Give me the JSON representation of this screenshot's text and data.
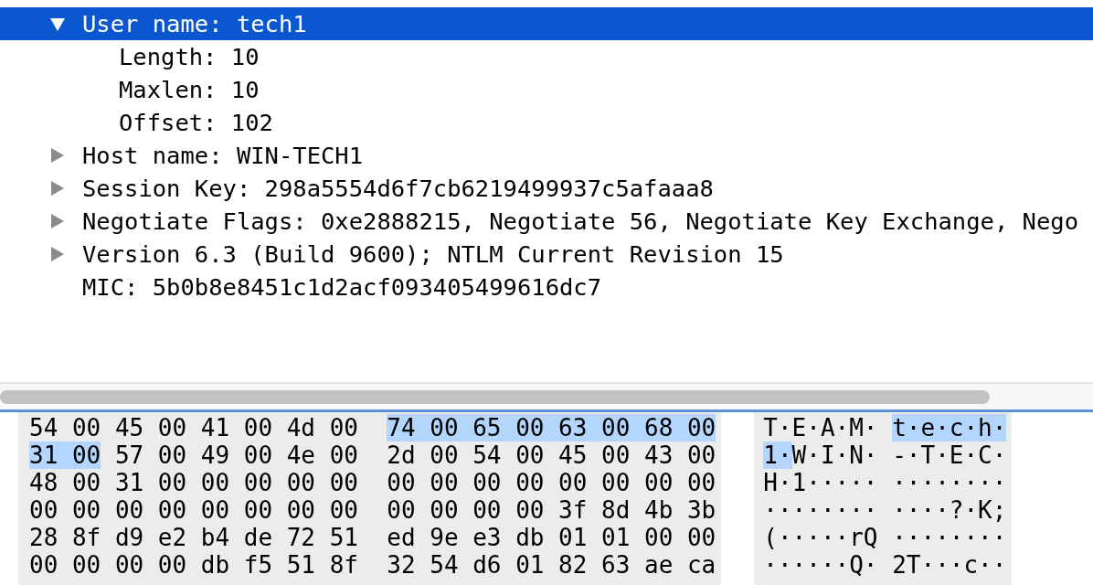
{
  "tree": [
    {
      "kind": "branch",
      "label": "User name: tech1",
      "selected": true,
      "expanded": true,
      "children": [
        {
          "label": "Length: 10",
          "selected": false
        },
        {
          "label": "Maxlen: 10",
          "selected": false
        },
        {
          "label": "Offset: 102",
          "selected": false
        }
      ]
    },
    {
      "kind": "branch",
      "label": "Host name: WIN-TECH1",
      "selected": false,
      "expanded": false
    },
    {
      "kind": "branch",
      "label": "Session Key: 298a5554d6f7cb6219499937c5afaaa8",
      "selected": false,
      "expanded": false
    },
    {
      "kind": "branch",
      "label": "Negotiate Flags: 0xe2888215, Negotiate 56, Negotiate Key Exchange, Nego",
      "selected": false,
      "expanded": false
    },
    {
      "kind": "branch",
      "label": "Version 6.3 (Build 9600); NTLM Current Revision 15",
      "selected": false,
      "expanded": false
    },
    {
      "kind": "leaf",
      "label": "MIC: 5b0b8e8451c1d2acf093405499616dc7",
      "selected": false
    }
  ],
  "hex_rows": [
    {
      "bytes": [
        {
          "hex": "54",
          "char": "T",
          "selected": false
        },
        {
          "hex": "00",
          "char": "·",
          "selected": false
        },
        {
          "hex": "45",
          "char": "E",
          "selected": false
        },
        {
          "hex": "00",
          "char": "·",
          "selected": false
        },
        {
          "hex": "41",
          "char": "A",
          "selected": false
        },
        {
          "hex": "00",
          "char": "·",
          "selected": false
        },
        {
          "hex": "4d",
          "char": "M",
          "selected": false
        },
        {
          "hex": "00",
          "char": "·",
          "selected": false
        },
        {
          "hex": "74",
          "char": "t",
          "selected": true
        },
        {
          "hex": "00",
          "char": "·",
          "selected": true
        },
        {
          "hex": "65",
          "char": "e",
          "selected": true
        },
        {
          "hex": "00",
          "char": "·",
          "selected": true
        },
        {
          "hex": "63",
          "char": "c",
          "selected": true
        },
        {
          "hex": "00",
          "char": "·",
          "selected": true
        },
        {
          "hex": "68",
          "char": "h",
          "selected": true
        },
        {
          "hex": "00",
          "char": "·",
          "selected": true
        }
      ]
    },
    {
      "bytes": [
        {
          "hex": "31",
          "char": "1",
          "selected": true
        },
        {
          "hex": "00",
          "char": "·",
          "selected": true
        },
        {
          "hex": "57",
          "char": "W",
          "selected": false
        },
        {
          "hex": "00",
          "char": "·",
          "selected": false
        },
        {
          "hex": "49",
          "char": "I",
          "selected": false
        },
        {
          "hex": "00",
          "char": "·",
          "selected": false
        },
        {
          "hex": "4e",
          "char": "N",
          "selected": false
        },
        {
          "hex": "00",
          "char": "·",
          "selected": false
        },
        {
          "hex": "2d",
          "char": "-",
          "selected": false
        },
        {
          "hex": "00",
          "char": "·",
          "selected": false
        },
        {
          "hex": "54",
          "char": "T",
          "selected": false
        },
        {
          "hex": "00",
          "char": "·",
          "selected": false
        },
        {
          "hex": "45",
          "char": "E",
          "selected": false
        },
        {
          "hex": "00",
          "char": "·",
          "selected": false
        },
        {
          "hex": "43",
          "char": "C",
          "selected": false
        },
        {
          "hex": "00",
          "char": "·",
          "selected": false
        }
      ]
    },
    {
      "bytes": [
        {
          "hex": "48",
          "char": "H",
          "selected": false
        },
        {
          "hex": "00",
          "char": "·",
          "selected": false
        },
        {
          "hex": "31",
          "char": "1",
          "selected": false
        },
        {
          "hex": "00",
          "char": "·",
          "selected": false
        },
        {
          "hex": "00",
          "char": "·",
          "selected": false
        },
        {
          "hex": "00",
          "char": "·",
          "selected": false
        },
        {
          "hex": "00",
          "char": "·",
          "selected": false
        },
        {
          "hex": "00",
          "char": "·",
          "selected": false
        },
        {
          "hex": "00",
          "char": "·",
          "selected": false
        },
        {
          "hex": "00",
          "char": "·",
          "selected": false
        },
        {
          "hex": "00",
          "char": "·",
          "selected": false
        },
        {
          "hex": "00",
          "char": "·",
          "selected": false
        },
        {
          "hex": "00",
          "char": "·",
          "selected": false
        },
        {
          "hex": "00",
          "char": "·",
          "selected": false
        },
        {
          "hex": "00",
          "char": "·",
          "selected": false
        },
        {
          "hex": "00",
          "char": "·",
          "selected": false
        }
      ]
    },
    {
      "bytes": [
        {
          "hex": "00",
          "char": "·",
          "selected": false
        },
        {
          "hex": "00",
          "char": "·",
          "selected": false
        },
        {
          "hex": "00",
          "char": "·",
          "selected": false
        },
        {
          "hex": "00",
          "char": "·",
          "selected": false
        },
        {
          "hex": "00",
          "char": "·",
          "selected": false
        },
        {
          "hex": "00",
          "char": "·",
          "selected": false
        },
        {
          "hex": "00",
          "char": "·",
          "selected": false
        },
        {
          "hex": "00",
          "char": "·",
          "selected": false
        },
        {
          "hex": "00",
          "char": "·",
          "selected": false
        },
        {
          "hex": "00",
          "char": "·",
          "selected": false
        },
        {
          "hex": "00",
          "char": "·",
          "selected": false
        },
        {
          "hex": "00",
          "char": "·",
          "selected": false
        },
        {
          "hex": "3f",
          "char": "?",
          "selected": false
        },
        {
          "hex": "8d",
          "char": "·",
          "selected": false
        },
        {
          "hex": "4b",
          "char": "K",
          "selected": false
        },
        {
          "hex": "3b",
          "char": ";",
          "selected": false
        }
      ]
    },
    {
      "bytes": [
        {
          "hex": "28",
          "char": "(",
          "selected": false
        },
        {
          "hex": "8f",
          "char": "·",
          "selected": false
        },
        {
          "hex": "d9",
          "char": "·",
          "selected": false
        },
        {
          "hex": "e2",
          "char": "·",
          "selected": false
        },
        {
          "hex": "b4",
          "char": "·",
          "selected": false
        },
        {
          "hex": "de",
          "char": "·",
          "selected": false
        },
        {
          "hex": "72",
          "char": "r",
          "selected": false
        },
        {
          "hex": "51",
          "char": "Q",
          "selected": false
        },
        {
          "hex": "ed",
          "char": "·",
          "selected": false
        },
        {
          "hex": "9e",
          "char": "·",
          "selected": false
        },
        {
          "hex": "e3",
          "char": "·",
          "selected": false
        },
        {
          "hex": "db",
          "char": "·",
          "selected": false
        },
        {
          "hex": "01",
          "char": "·",
          "selected": false
        },
        {
          "hex": "01",
          "char": "·",
          "selected": false
        },
        {
          "hex": "00",
          "char": "·",
          "selected": false
        },
        {
          "hex": "00",
          "char": "·",
          "selected": false
        }
      ]
    },
    {
      "bytes": [
        {
          "hex": "00",
          "char": "·",
          "selected": false
        },
        {
          "hex": "00",
          "char": "·",
          "selected": false
        },
        {
          "hex": "00",
          "char": "·",
          "selected": false
        },
        {
          "hex": "00",
          "char": "·",
          "selected": false
        },
        {
          "hex": "db",
          "char": "·",
          "selected": false
        },
        {
          "hex": "f5",
          "char": "·",
          "selected": false
        },
        {
          "hex": "51",
          "char": "Q",
          "selected": false
        },
        {
          "hex": "8f",
          "char": "·",
          "selected": false
        },
        {
          "hex": "32",
          "char": "2",
          "selected": false
        },
        {
          "hex": "54",
          "char": "T",
          "selected": false
        },
        {
          "hex": "d6",
          "char": "·",
          "selected": false
        },
        {
          "hex": "01",
          "char": "·",
          "selected": false
        },
        {
          "hex": "82",
          "char": "·",
          "selected": false
        },
        {
          "hex": "63",
          "char": "c",
          "selected": false
        },
        {
          "hex": "ae",
          "char": "·",
          "selected": false
        },
        {
          "hex": "ca",
          "char": "·",
          "selected": false
        }
      ]
    }
  ]
}
